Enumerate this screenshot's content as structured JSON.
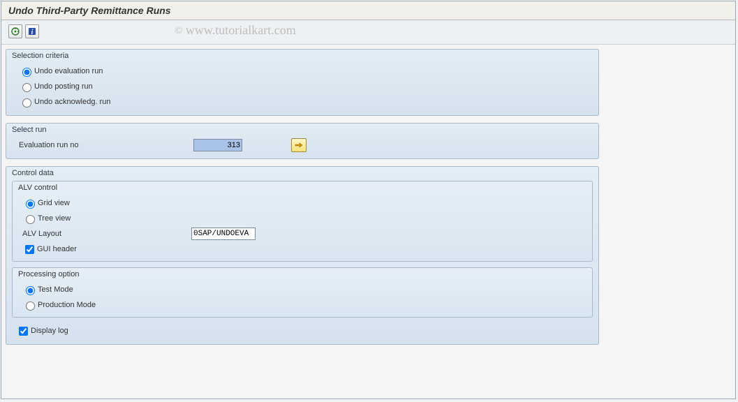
{
  "window": {
    "title": "Undo Third-Party Remittance Runs"
  },
  "watermark": "www.tutorialkart.com",
  "toolbar": {
    "execute_icon": "execute",
    "info_icon": "info"
  },
  "selection_criteria": {
    "title": "Selection criteria",
    "opt1": "Undo evaluation run",
    "opt2": "Undo posting run",
    "opt3": "Undo acknowledg. run",
    "selected": "opt1"
  },
  "select_run": {
    "title": "Select run",
    "label": "Evaluation run no",
    "value": "313"
  },
  "control_data": {
    "title": "Control data",
    "alv": {
      "title": "ALV control",
      "grid": "Grid view",
      "tree": "Tree view",
      "layout_label": "ALV Layout",
      "layout_value": "0SAP/UNDOEVA",
      "gui_header": "GUI header",
      "selected": "grid",
      "gui_checked": true
    },
    "processing": {
      "title": "Processing option",
      "test": "Test Mode",
      "prod": "Production Mode",
      "selected": "test"
    },
    "display_log": {
      "label": "Display log",
      "checked": true
    }
  }
}
